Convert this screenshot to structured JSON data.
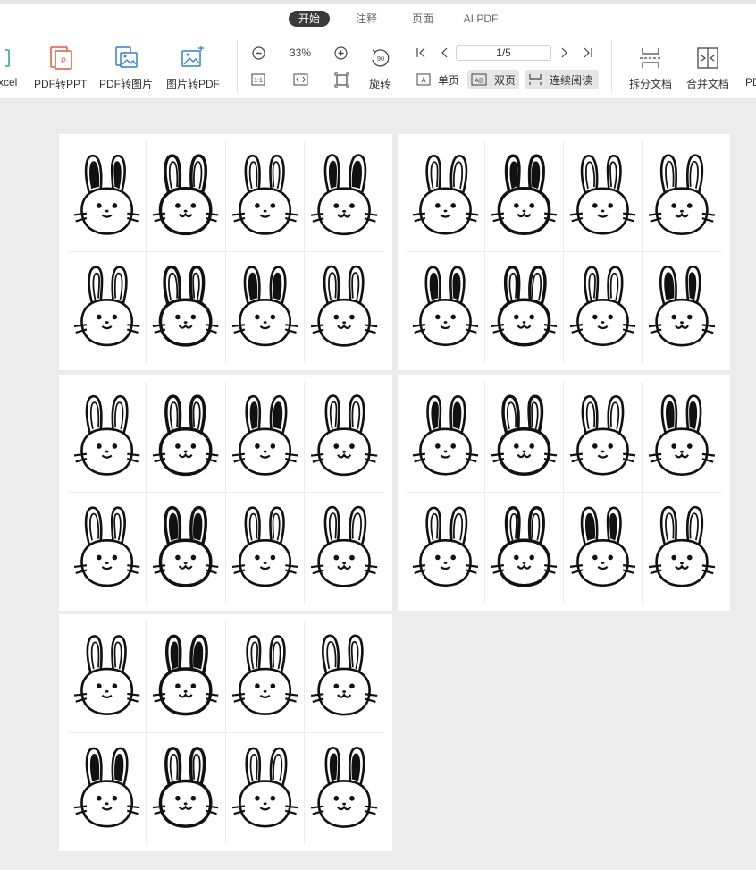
{
  "tabs": [
    {
      "label": "开始",
      "active": true
    },
    {
      "label": "注释",
      "active": false
    },
    {
      "label": "页面",
      "active": false
    },
    {
      "label": "AI PDF",
      "active": false
    }
  ],
  "tools": {
    "excel_label": "xcel",
    "pdf_to_ppt": "PDF转PPT",
    "pdf_to_image": "PDF转图片",
    "image_to_pdf": "图片转PDF",
    "rotate": "旋转",
    "split": "拆分文档",
    "merge": "合并文档",
    "pd_label": "PD"
  },
  "zoom": {
    "value": "33%"
  },
  "pagination": {
    "current": "1/5"
  },
  "rotate_badge": "90",
  "view": {
    "single": "单页",
    "double": "双页",
    "continuous": "连续阅读",
    "double_icon": "AB",
    "single_icon": "A"
  },
  "colors": {
    "accent_red": "#e8563f",
    "accent_blue": "#2f7fd6",
    "accent_teal": "#1ba98f",
    "page_bg": "#ececec"
  },
  "pages": [
    {
      "page": 1,
      "rabbits": 8
    },
    {
      "page": 2,
      "rabbits": 8
    },
    {
      "page": 3,
      "rabbits": 8
    },
    {
      "page": 4,
      "rabbits": 8
    },
    {
      "page": 5,
      "rabbits": 8
    }
  ]
}
